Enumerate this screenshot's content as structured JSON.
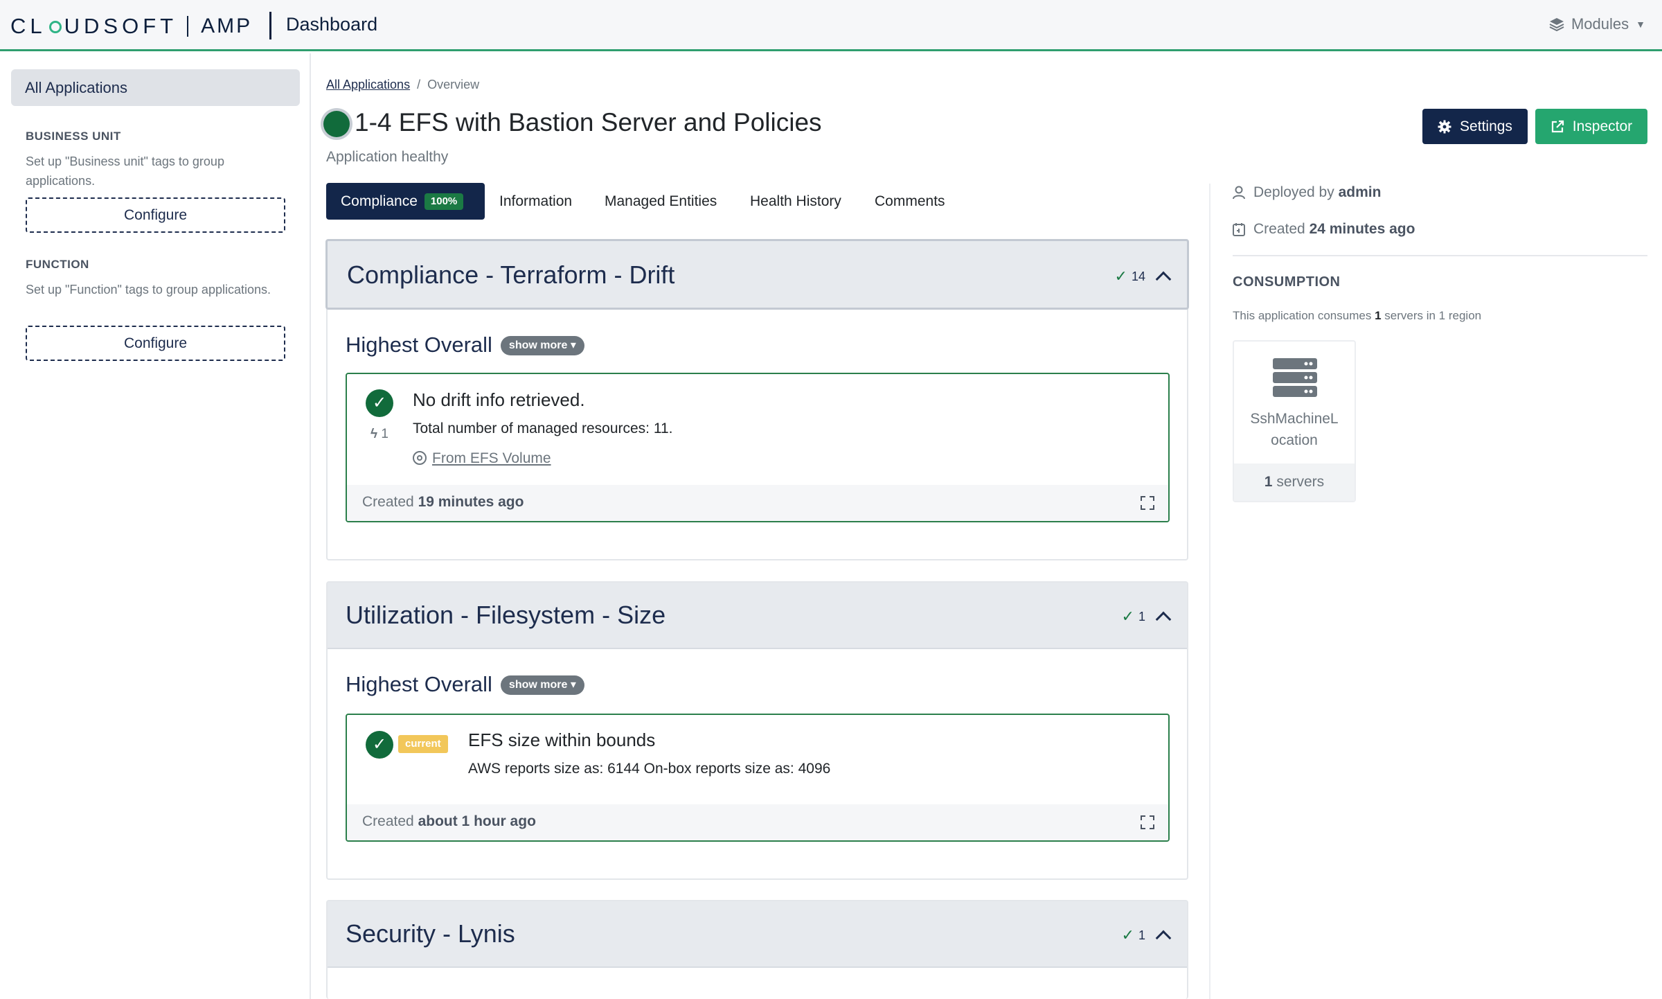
{
  "header": {
    "logo_left": "CL",
    "logo_right": "UDSOFT",
    "logo_product": "AMP",
    "title": "Dashboard",
    "modules_label": "Modules"
  },
  "sidebar": {
    "all_applications": "All Applications",
    "groups": [
      {
        "heading": "BUSINESS UNIT",
        "text": "Set up \"Business unit\" tags to group applications.",
        "button": "Configure"
      },
      {
        "heading": "FUNCTION",
        "text": "Set up \"Function\" tags to group applications.",
        "button": "Configure"
      }
    ]
  },
  "breadcrumb": {
    "link": "All Applications",
    "separator": "/",
    "current": "Overview"
  },
  "app": {
    "title": "1-4 EFS with Bastion Server and Policies",
    "status": "Application healthy",
    "status_color": "#116b3b",
    "settings_label": "Settings",
    "inspector_label": "Inspector"
  },
  "tabs": [
    {
      "label": "Compliance",
      "badge": "100%",
      "active": true
    },
    {
      "label": "Information"
    },
    {
      "label": "Managed Entities"
    },
    {
      "label": "Health History"
    },
    {
      "label": "Comments"
    }
  ],
  "panels": [
    {
      "title": "Compliance - Terraform - Drift",
      "count": "14",
      "subheading": "Highest Overall",
      "show_more": "show more",
      "card": {
        "title": "No drift info retrieved.",
        "text": "Total number of managed resources: 11.",
        "events": "1",
        "source_link": "From EFS Volume",
        "created_prefix": "Created",
        "created_value": "19 minutes ago"
      }
    },
    {
      "title": "Utilization - Filesystem - Size",
      "count": "1",
      "subheading": "Highest Overall",
      "show_more": "show more",
      "card": {
        "badge": "current",
        "title": "EFS size within bounds",
        "text": "AWS reports size as: 6144 On-box reports size as: 4096",
        "created_prefix": "Created",
        "created_value": "about 1 hour ago"
      }
    },
    {
      "title": "Security - Lynis",
      "count": "1"
    }
  ],
  "details": {
    "deployed_prefix": "Deployed by",
    "deployed_by": "admin",
    "created_prefix": "Created",
    "created_value": "24 minutes ago",
    "consumption_heading": "CONSUMPTION",
    "consumption_pre": "This application consumes",
    "consumption_count": "1",
    "consumption_post": "servers in 1 region",
    "location_name_1": "SshMachineL",
    "location_name_2": "ocation",
    "location_servers": "1",
    "location_servers_suffix": "servers"
  },
  "colors": {
    "navy": "#13264a",
    "green_accent": "#25a66f",
    "success": "#116b3b",
    "warning_badge": "#f2c75a"
  }
}
